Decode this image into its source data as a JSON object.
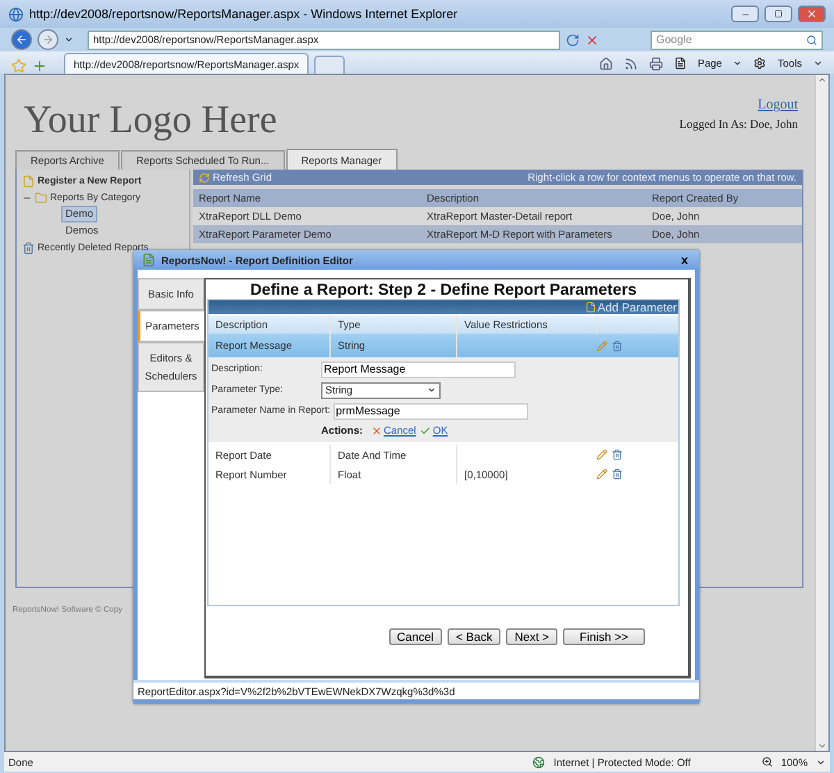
{
  "browser": {
    "title": "http://dev2008/reportsnow/ReportsManager.aspx - Windows Internet Explorer",
    "address": "http://dev2008/reportsnow/ReportsManager.aspx",
    "search": {
      "placeholder": "Google"
    },
    "tabs": [
      {
        "label": "http://dev2008/reportsnow/ReportsManager.aspx",
        "selected": true
      }
    ],
    "menus": [
      "Page",
      "Tools"
    ],
    "status": "Done",
    "zone": "Internet | Protected Mode: Off",
    "zoom": "100%"
  },
  "page": {
    "logo": "Your Logo Here",
    "logout": "Logout",
    "logged_in": "Logged In As: Doe, John",
    "tabs": [
      {
        "label": "Reports Archive",
        "selected": false
      },
      {
        "label": "Reports Scheduled To Run...",
        "selected": false
      },
      {
        "label": "Reports Manager",
        "selected": true
      }
    ],
    "tree": [
      {
        "label": "Register a New Report",
        "kind": "action"
      },
      {
        "label": "Reports By Category",
        "kind": "folder",
        "expanded": true,
        "children": [
          {
            "label": "Demo",
            "selected": true
          },
          {
            "label": "Demos",
            "selected": false
          }
        ]
      },
      {
        "label": "Recently Deleted Reports",
        "kind": "trash"
      }
    ],
    "grid": {
      "refresh": "Refresh Grid",
      "hint": "Right-click a row for context menus to operate on that row.",
      "columns": [
        "Report Name",
        "Description",
        "Report Created By"
      ],
      "rows": [
        {
          "cells": [
            "XtraReport DLL Demo",
            "XtraReport Master-Detail report",
            "Doe, John"
          ],
          "selected": false
        },
        {
          "cells": [
            "XtraReport Parameter Demo",
            "XtraReport M-D Report with Parameters",
            "Doe, John"
          ],
          "selected": true
        }
      ]
    },
    "footer": "ReportsNow! Software © Copy"
  },
  "dialog": {
    "title": "ReportsNow! - Report Definition Editor",
    "close": "x",
    "side_tabs": [
      {
        "label": "Basic Info",
        "selected": false
      },
      {
        "label": "Parameters",
        "selected": true
      },
      {
        "label": "Editors & Schedulers",
        "selected": false
      }
    ],
    "heading": "Define a Report: Step 2 - Define Report Parameters",
    "add": "Add Parameter",
    "columns": [
      "Description",
      "Type",
      "Value Restrictions"
    ],
    "rows": [
      {
        "description": "Report Message",
        "type": "String",
        "selected": true,
        "expanded": true
      },
      {
        "description": "Report Date",
        "type": "Date And Time",
        "selected": false,
        "expanded": false
      },
      {
        "description": "Report Number",
        "type": "Float",
        "restrictions": "[0,10000]",
        "selected": false,
        "expanded": false
      }
    ],
    "form": {
      "fields": [
        {
          "label": "Description:",
          "value": "Report Message",
          "kind": "text"
        },
        {
          "label": "Parameter Type:",
          "value": "String",
          "kind": "select"
        },
        {
          "label": "Parameter Name in Report:",
          "value": "prmMessage",
          "kind": "text"
        }
      ],
      "actions_label": "Actions:",
      "actions": [
        {
          "label": "Cancel",
          "kind": "cancel"
        },
        {
          "label": "OK",
          "kind": "ok"
        }
      ]
    },
    "buttons": [
      "Cancel",
      "< Back",
      "Next >",
      "Finish >>"
    ],
    "status": "ReportEditor.aspx?id=V%2f2b%2bVTEwEWNekDX7Wzqkg%3d%3d"
  }
}
